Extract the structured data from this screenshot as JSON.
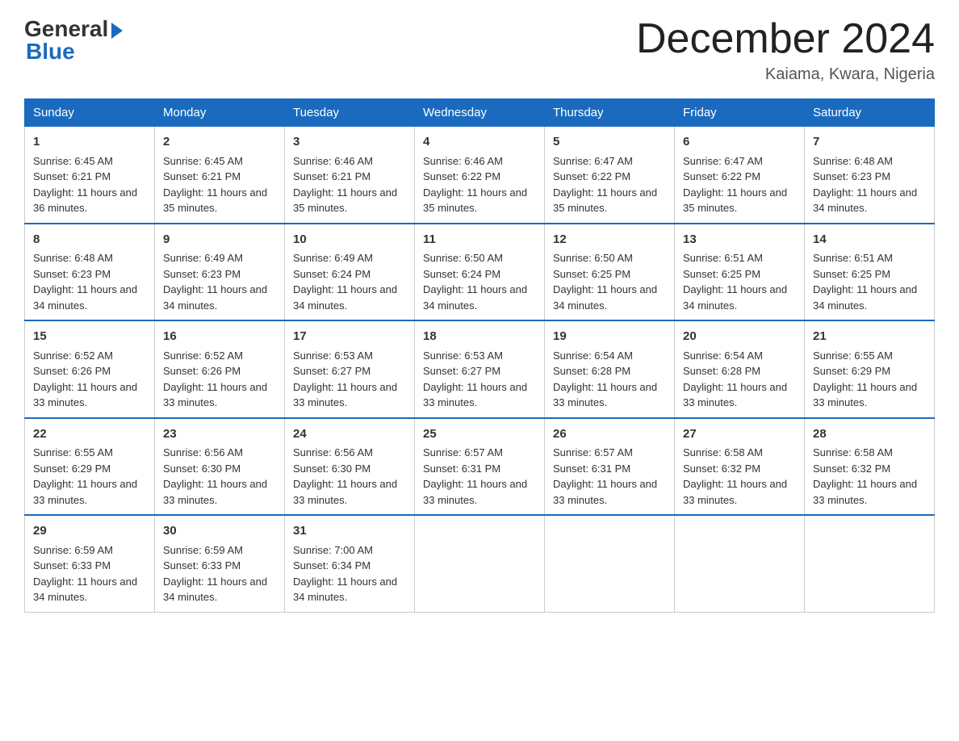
{
  "logo": {
    "general": "General",
    "blue": "Blue"
  },
  "title": "December 2024",
  "subtitle": "Kaiama, Kwara, Nigeria",
  "weekdays": [
    "Sunday",
    "Monday",
    "Tuesday",
    "Wednesday",
    "Thursday",
    "Friday",
    "Saturday"
  ],
  "weeks": [
    [
      {
        "day": "1",
        "sunrise": "6:45 AM",
        "sunset": "6:21 PM",
        "daylight": "11 hours and 36 minutes."
      },
      {
        "day": "2",
        "sunrise": "6:45 AM",
        "sunset": "6:21 PM",
        "daylight": "11 hours and 35 minutes."
      },
      {
        "day": "3",
        "sunrise": "6:46 AM",
        "sunset": "6:21 PM",
        "daylight": "11 hours and 35 minutes."
      },
      {
        "day": "4",
        "sunrise": "6:46 AM",
        "sunset": "6:22 PM",
        "daylight": "11 hours and 35 minutes."
      },
      {
        "day": "5",
        "sunrise": "6:47 AM",
        "sunset": "6:22 PM",
        "daylight": "11 hours and 35 minutes."
      },
      {
        "day": "6",
        "sunrise": "6:47 AM",
        "sunset": "6:22 PM",
        "daylight": "11 hours and 35 minutes."
      },
      {
        "day": "7",
        "sunrise": "6:48 AM",
        "sunset": "6:23 PM",
        "daylight": "11 hours and 34 minutes."
      }
    ],
    [
      {
        "day": "8",
        "sunrise": "6:48 AM",
        "sunset": "6:23 PM",
        "daylight": "11 hours and 34 minutes."
      },
      {
        "day": "9",
        "sunrise": "6:49 AM",
        "sunset": "6:23 PM",
        "daylight": "11 hours and 34 minutes."
      },
      {
        "day": "10",
        "sunrise": "6:49 AM",
        "sunset": "6:24 PM",
        "daylight": "11 hours and 34 minutes."
      },
      {
        "day": "11",
        "sunrise": "6:50 AM",
        "sunset": "6:24 PM",
        "daylight": "11 hours and 34 minutes."
      },
      {
        "day": "12",
        "sunrise": "6:50 AM",
        "sunset": "6:25 PM",
        "daylight": "11 hours and 34 minutes."
      },
      {
        "day": "13",
        "sunrise": "6:51 AM",
        "sunset": "6:25 PM",
        "daylight": "11 hours and 34 minutes."
      },
      {
        "day": "14",
        "sunrise": "6:51 AM",
        "sunset": "6:25 PM",
        "daylight": "11 hours and 34 minutes."
      }
    ],
    [
      {
        "day": "15",
        "sunrise": "6:52 AM",
        "sunset": "6:26 PM",
        "daylight": "11 hours and 33 minutes."
      },
      {
        "day": "16",
        "sunrise": "6:52 AM",
        "sunset": "6:26 PM",
        "daylight": "11 hours and 33 minutes."
      },
      {
        "day": "17",
        "sunrise": "6:53 AM",
        "sunset": "6:27 PM",
        "daylight": "11 hours and 33 minutes."
      },
      {
        "day": "18",
        "sunrise": "6:53 AM",
        "sunset": "6:27 PM",
        "daylight": "11 hours and 33 minutes."
      },
      {
        "day": "19",
        "sunrise": "6:54 AM",
        "sunset": "6:28 PM",
        "daylight": "11 hours and 33 minutes."
      },
      {
        "day": "20",
        "sunrise": "6:54 AM",
        "sunset": "6:28 PM",
        "daylight": "11 hours and 33 minutes."
      },
      {
        "day": "21",
        "sunrise": "6:55 AM",
        "sunset": "6:29 PM",
        "daylight": "11 hours and 33 minutes."
      }
    ],
    [
      {
        "day": "22",
        "sunrise": "6:55 AM",
        "sunset": "6:29 PM",
        "daylight": "11 hours and 33 minutes."
      },
      {
        "day": "23",
        "sunrise": "6:56 AM",
        "sunset": "6:30 PM",
        "daylight": "11 hours and 33 minutes."
      },
      {
        "day": "24",
        "sunrise": "6:56 AM",
        "sunset": "6:30 PM",
        "daylight": "11 hours and 33 minutes."
      },
      {
        "day": "25",
        "sunrise": "6:57 AM",
        "sunset": "6:31 PM",
        "daylight": "11 hours and 33 minutes."
      },
      {
        "day": "26",
        "sunrise": "6:57 AM",
        "sunset": "6:31 PM",
        "daylight": "11 hours and 33 minutes."
      },
      {
        "day": "27",
        "sunrise": "6:58 AM",
        "sunset": "6:32 PM",
        "daylight": "11 hours and 33 minutes."
      },
      {
        "day": "28",
        "sunrise": "6:58 AM",
        "sunset": "6:32 PM",
        "daylight": "11 hours and 33 minutes."
      }
    ],
    [
      {
        "day": "29",
        "sunrise": "6:59 AM",
        "sunset": "6:33 PM",
        "daylight": "11 hours and 34 minutes."
      },
      {
        "day": "30",
        "sunrise": "6:59 AM",
        "sunset": "6:33 PM",
        "daylight": "11 hours and 34 minutes."
      },
      {
        "day": "31",
        "sunrise": "7:00 AM",
        "sunset": "6:34 PM",
        "daylight": "11 hours and 34 minutes."
      },
      null,
      null,
      null,
      null
    ]
  ],
  "labels": {
    "sunrise": "Sunrise: ",
    "sunset": "Sunset: ",
    "daylight": "Daylight: "
  }
}
